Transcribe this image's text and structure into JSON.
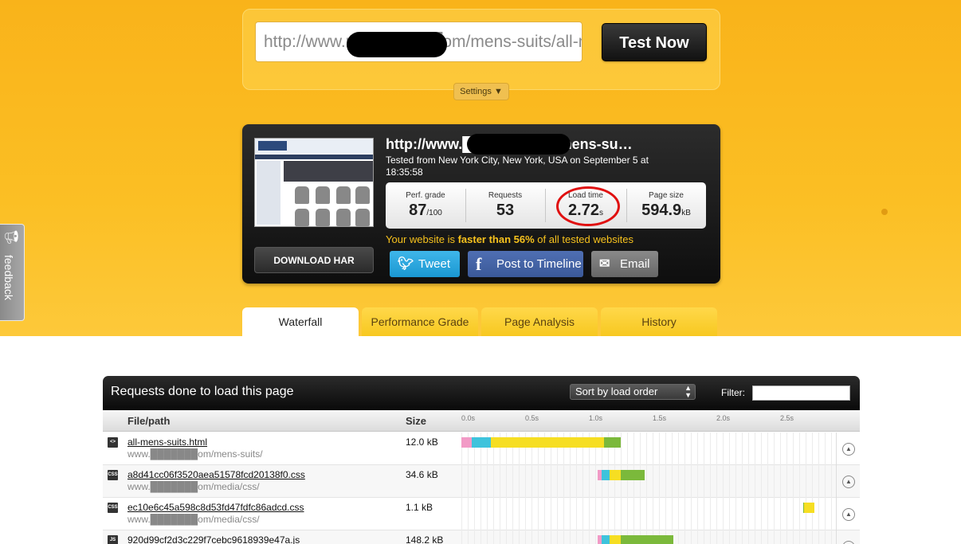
{
  "search": {
    "url": "http://www.m███████om/mens-suits/all-m",
    "test_label": "Test Now",
    "settings_label": "Settings ▼"
  },
  "result": {
    "url": "http://www.███████om/mens-su…",
    "tested_from": "Tested from New York City, New York, USA on September 5 at 18:35:58",
    "download_label": "DOWNLOAD HAR",
    "stats": [
      {
        "label": "Perf. grade",
        "value": "87",
        "unit": "/100"
      },
      {
        "label": "Requests",
        "value": "53",
        "unit": ""
      },
      {
        "label": "Load time",
        "value": "2.72",
        "unit": "s"
      },
      {
        "label": "Page size",
        "value": "594.9",
        "unit": "kB"
      }
    ],
    "faster_prefix": "Your website is ",
    "faster_bold": "faster than 56%",
    "faster_suffix": " of all tested websites",
    "share": {
      "tweet": "Tweet",
      "post": "Post to Timeline",
      "email": "Email"
    }
  },
  "tabs": [
    "Waterfall",
    "Performance Grade",
    "Page Analysis",
    "History"
  ],
  "feedback": "feedback",
  "panel": {
    "title": "Requests done to load this page",
    "sort_label": "Sort by load order",
    "filter_label": "Filter:",
    "col_file": "File/path",
    "col_size": "Size",
    "ticks": [
      "0.0s",
      "0.5s",
      "1.0s",
      "1.5s",
      "2.0s",
      "2.5s"
    ],
    "rows": [
      {
        "type": "<>",
        "name": "all-mens-suits.html",
        "path": "www.███████om/mens-suits/",
        "size": "12.0 kB",
        "segments": [
          [
            0.0,
            0.08,
            "#f29ac6"
          ],
          [
            0.08,
            0.23,
            "#3ec3dc"
          ],
          [
            0.23,
            1.12,
            "#f6de22"
          ],
          [
            1.12,
            1.25,
            "#7bb93b"
          ]
        ]
      },
      {
        "type": "CSS",
        "name": "a8d41cc06f3520aea51578fcd20138f0.css",
        "path": "www.███████om/media/css/",
        "size": "34.6 kB",
        "segments": [
          [
            1.07,
            1.1,
            "#f29ac6"
          ],
          [
            1.1,
            1.16,
            "#3ec3dc"
          ],
          [
            1.16,
            1.25,
            "#f6de22"
          ],
          [
            1.25,
            1.44,
            "#7bb93b"
          ]
        ]
      },
      {
        "type": "CSS",
        "name": "ec10e6c45a598c8d53fd47fdfc86adcd.css",
        "path": "www.███████om/media/css/",
        "size": "1.1 kB",
        "segments": [
          [
            2.68,
            2.69,
            "#7bb93b"
          ],
          [
            2.69,
            2.77,
            "#f6de22"
          ]
        ]
      },
      {
        "type": "JS",
        "name": "920d99cf2d3c229f7cebc9618939e47a.js",
        "path": "",
        "size": "148.2 kB",
        "segments": [
          [
            1.07,
            1.1,
            "#f29ac6"
          ],
          [
            1.1,
            1.16,
            "#3ec3dc"
          ],
          [
            1.16,
            1.25,
            "#f6de22"
          ],
          [
            1.25,
            1.66,
            "#7bb93b"
          ]
        ]
      }
    ]
  }
}
